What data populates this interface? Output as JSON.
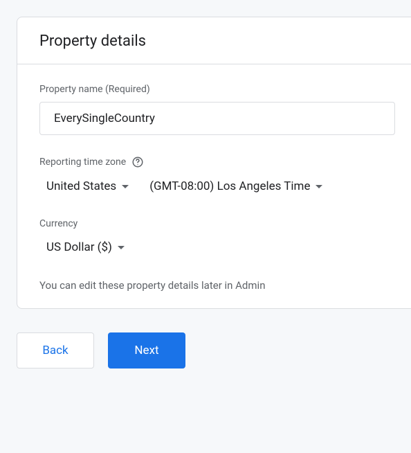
{
  "card": {
    "title": "Property details",
    "propertyName": {
      "label": "Property name (Required)",
      "value": "EverySingleCountry"
    },
    "timezone": {
      "label": "Reporting time zone",
      "country": "United States",
      "zone": "(GMT-08:00) Los Angeles Time"
    },
    "currency": {
      "label": "Currency",
      "value": "US Dollar ($)"
    },
    "note": "You can edit these property details later in Admin"
  },
  "footer": {
    "back": "Back",
    "next": "Next"
  }
}
